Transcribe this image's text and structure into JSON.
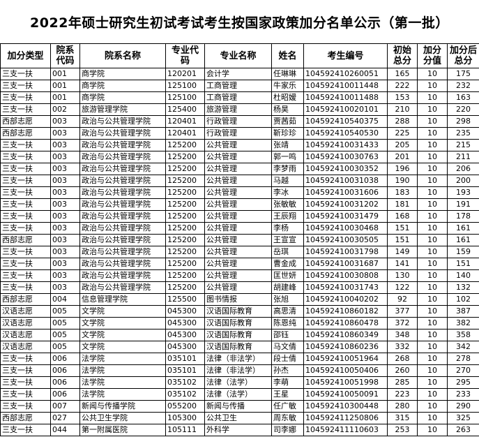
{
  "title": "2022年硕士研究生初试考试考生按国家政策加分名单公示（第一批）",
  "headers": [
    "加分类型",
    "院系代码",
    "院系名称",
    "专业代码",
    "专业名称",
    "姓名",
    "考生编号",
    "初始总分",
    "加分分值",
    "加分后总分"
  ],
  "rows": [
    [
      "三支一扶",
      "001",
      "商学院",
      "120201",
      "会计学",
      "任琳琳",
      "104592410260051",
      "165",
      "10",
      "175"
    ],
    [
      "三支一扶",
      "001",
      "商学院",
      "125100",
      "工商管理",
      "牛家乐",
      "104592410011448",
      "222",
      "10",
      "232"
    ],
    [
      "三支一扶",
      "001",
      "商学院",
      "125100",
      "工商管理",
      "杜昭嫒",
      "104592410011488",
      "153",
      "10",
      "163"
    ],
    [
      "三支一扶",
      "002",
      "旅游管理学院",
      "125400",
      "旅游管理",
      "杨昊",
      "104592410020101",
      "210",
      "10",
      "220"
    ],
    [
      "西部志愿",
      "003",
      "政治与公共管理学院",
      "120401",
      "行政管理",
      "贾茜茹",
      "104592410540375",
      "288",
      "10",
      "298"
    ],
    [
      "西部志愿",
      "003",
      "政治与公共管理学院",
      "120401",
      "行政管理",
      "靳珍珍",
      "104592410540530",
      "225",
      "10",
      "235"
    ],
    [
      "三支一扶",
      "003",
      "政治与公共管理学院",
      "125200",
      "公共管理",
      "张靖",
      "104592410031433",
      "205",
      "10",
      "215"
    ],
    [
      "三支一扶",
      "003",
      "政治与公共管理学院",
      "125200",
      "公共管理",
      "郭一鸣",
      "104592410030763",
      "201",
      "10",
      "211"
    ],
    [
      "三支一扶",
      "003",
      "政治与公共管理学院",
      "125200",
      "公共管理",
      "李梦雨",
      "104592410030352",
      "196",
      "10",
      "206"
    ],
    [
      "三支一扶",
      "003",
      "政治与公共管理学院",
      "125200",
      "公共管理",
      "马越",
      "104592410031038",
      "190",
      "10",
      "200"
    ],
    [
      "三支一扶",
      "003",
      "政治与公共管理学院",
      "125200",
      "公共管理",
      "李冰",
      "104592410031606",
      "183",
      "10",
      "193"
    ],
    [
      "三支一扶",
      "003",
      "政治与公共管理学院",
      "125200",
      "公共管理",
      "张敏敏",
      "104592410031202",
      "181",
      "10",
      "191"
    ],
    [
      "三支一扶",
      "003",
      "政治与公共管理学院",
      "125200",
      "公共管理",
      "王辰翔",
      "104592410031479",
      "168",
      "10",
      "178"
    ],
    [
      "三支一扶",
      "003",
      "政治与公共管理学院",
      "125200",
      "公共管理",
      "李杨",
      "104592410030468",
      "151",
      "10",
      "161"
    ],
    [
      "西部志愿",
      "003",
      "政治与公共管理学院",
      "125200",
      "公共管理",
      "王宣宣",
      "104592410030505",
      "151",
      "10",
      "161"
    ],
    [
      "三支一扶",
      "003",
      "政治与公共管理学院",
      "125200",
      "公共管理",
      "岳琪",
      "104592410031798",
      "149",
      "10",
      "159"
    ],
    [
      "三支一扶",
      "003",
      "政治与公共管理学院",
      "125200",
      "公共管理",
      "曹金成",
      "104592410031687",
      "141",
      "10",
      "151"
    ],
    [
      "三支一扶",
      "003",
      "政治与公共管理学院",
      "125200",
      "公共管理",
      "匡世妍",
      "104592410030808",
      "130",
      "10",
      "140"
    ],
    [
      "三支一扶",
      "003",
      "政治与公共管理学院",
      "125200",
      "公共管理",
      "胡建峰",
      "104592410031743",
      "122",
      "10",
      "132"
    ],
    [
      "西部志愿",
      "004",
      "信息管理学院",
      "125500",
      "图书情报",
      "张旭",
      "104592410040202",
      "92",
      "10",
      "102"
    ],
    [
      "汉语志愿",
      "005",
      "文学院",
      "045300",
      "汉语国际教育",
      "高思清",
      "104592410860182",
      "377",
      "10",
      "387"
    ],
    [
      "汉语志愿",
      "005",
      "文学院",
      "045300",
      "汉语国际教育",
      "陈恩纯",
      "104592410860478",
      "372",
      "10",
      "382"
    ],
    [
      "汉语志愿",
      "005",
      "文学院",
      "045300",
      "汉语国际教育",
      "邵钰",
      "104592410860349",
      "348",
      "10",
      "358"
    ],
    [
      "汉语志愿",
      "005",
      "文学院",
      "045300",
      "汉语国际教育",
      "马文倩",
      "104592410860236",
      "332",
      "10",
      "342"
    ],
    [
      "三支一扶",
      "006",
      "法学院",
      "035101",
      "法律（非法学）",
      "段士倩",
      "104592410051964",
      "268",
      "10",
      "278"
    ],
    [
      "三支一扶",
      "006",
      "法学院",
      "035101",
      "法律（非法学）",
      "孙杰",
      "104592410050406",
      "260",
      "10",
      "270"
    ],
    [
      "三支一扶",
      "006",
      "法学院",
      "035102",
      "法律（法学）",
      "李萌",
      "104592410051998",
      "285",
      "10",
      "295"
    ],
    [
      "三支一扶",
      "006",
      "法学院",
      "035102",
      "法律（法学）",
      "王星",
      "104592410050091",
      "223",
      "10",
      "233"
    ],
    [
      "三支一扶",
      "007",
      "新闻与传播学院",
      "055200",
      "新闻与传播",
      "任广敏",
      "104592410300448",
      "280",
      "10",
      "290"
    ],
    [
      "西部志愿",
      "027",
      "公共卫生学院",
      "105300",
      "公共卫生",
      "周东敏",
      "104592411250806",
      "315",
      "10",
      "325"
    ],
    [
      "三支一扶",
      "044",
      "第一附属医院",
      "105111",
      "外科学",
      "司李娜",
      "104592411110603",
      "253",
      "10",
      "263"
    ]
  ]
}
